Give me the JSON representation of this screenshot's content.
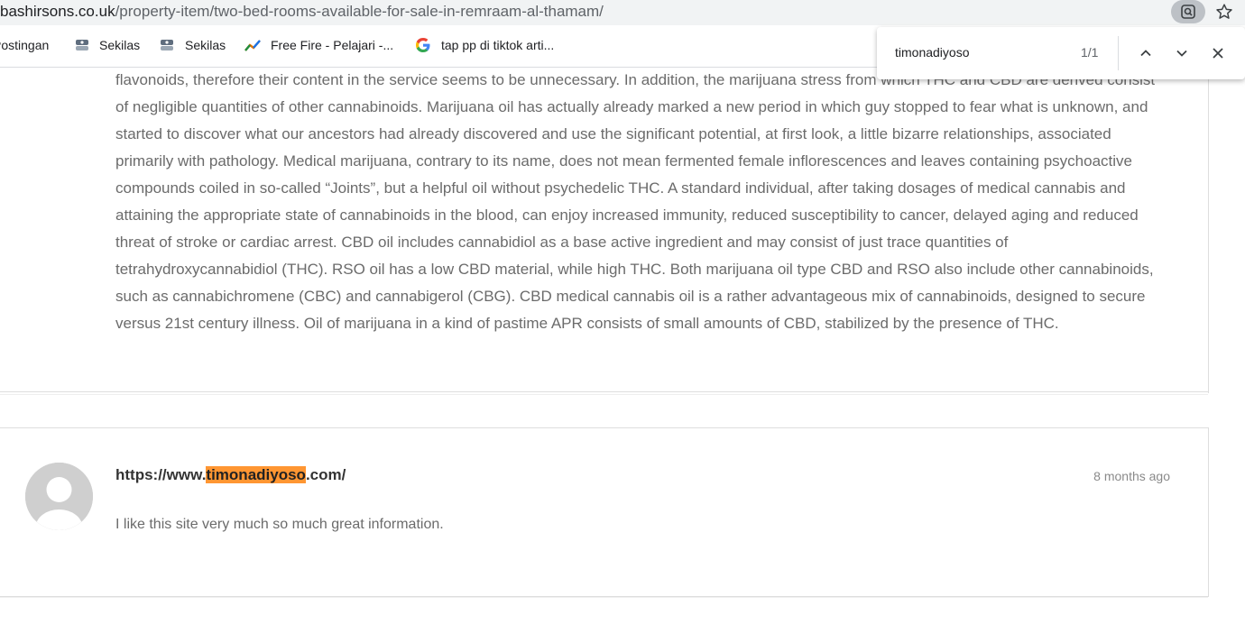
{
  "browser": {
    "url_domain": "bashirsons.co.uk",
    "url_path": "/property-item/two-bed-rooms-available-for-sale-in-remraam-al-thamam/",
    "lens_icon": "lens-search-icon",
    "star_icon": "bookmark-star-icon"
  },
  "bookmarks": [
    {
      "label": "Postingan"
    },
    {
      "label": "Sekilas",
      "icon": "blogger-icon"
    },
    {
      "label": "Sekilas",
      "icon": "blogger-icon"
    },
    {
      "label": "Free Fire - Pelajari -...",
      "icon": "analytics-trend-icon"
    },
    {
      "label": "tap pp di tiktok arti...",
      "icon": "google-g-icon"
    }
  ],
  "find": {
    "query": "timonadiyoso",
    "count": "1/1",
    "prev_icon": "chevron-up-icon",
    "next_icon": "chevron-down-icon",
    "close_icon": "close-icon"
  },
  "article": {
    "lines": [
      "flavonoids, therefore their content in the service seems to be unnecessary. In addition, the marijuana stress from which THC and CBD are derived consist",
      "of negligible quantities of other cannabinoids. Marijuana oil has actually already marked a new period in which guy stopped to fear what is unknown, and",
      "started to discover what our ancestors had already discovered and use the significant potential, at first look, a little bizarre relationships, associated",
      "primarily with pathology. Medical marijuana, contrary to its name, does not mean fermented female inflorescences and leaves containing psychoactive",
      "compounds coiled in so-called “Joints”, but a helpful oil without psychedelic THC. A standard individual, after taking dosages of medical cannabis and",
      "attaining the appropriate state of cannabinoids in the blood, can enjoy increased immunity, reduced susceptibility to cancer, delayed aging and reduced",
      "threat of stroke or cardiac arrest. CBD oil includes cannabidiol as a base active ingredient and may consist of just trace quantities of",
      "tetrahydroxycannabidiol (THC). RSO oil has a low CBD material, while high THC. Both marijuana oil type CBD and RSO also include other cannabinoids,",
      "such as cannabichromene (CBC) and cannabigerol (CBG). CBD medical cannabis oil is a rather advantageous mix of cannabinoids, designed to secure",
      "versus 21st century illness. Oil of marijuana in a kind of pastime APR consists of small amounts of CBD, stabilized by the presence of THC."
    ]
  },
  "comment": {
    "author_prefix": "https://www.",
    "author_highlight": "timonadiyoso",
    "author_suffix": ".com/",
    "date": "8 months ago",
    "text": "I like this site very much so much great information.",
    "avatar_icon": "default-avatar-icon"
  },
  "colors": {
    "highlight": "#ff9632",
    "body_text": "#6b6b6b"
  }
}
